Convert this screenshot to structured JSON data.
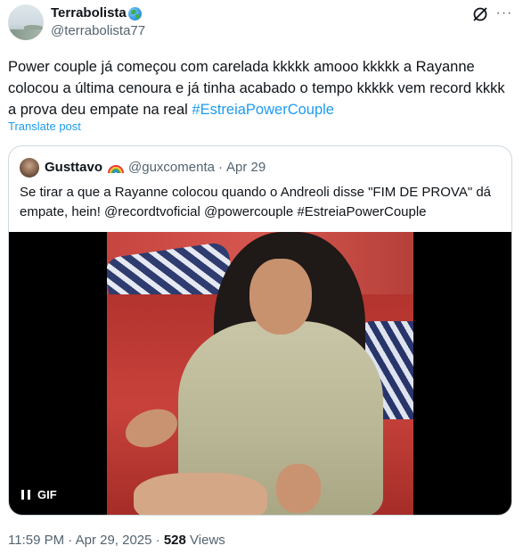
{
  "post": {
    "author_name": "Terrabolista",
    "author_emoji_icon": "globe-icon",
    "author_handle": "@terrabolista77",
    "text": "Power couple já começou com carelada kkkkk amooo kkkkk a Rayanne colocou a última cenoura e já tinha acabado o tempo kkkkk vem record kkkk a prova deu empate na real ",
    "hashtag": "#EstreiaPowerCouple",
    "translate_label": "Translate post",
    "timestamp": "11:59 PM · Apr 29, 2025",
    "views_count": "528",
    "views_label": "Views"
  },
  "quote": {
    "author_name": "Gusttavo",
    "author_emoji_icon": "rainbow-icon",
    "author_handle": "@guxcomenta",
    "separator": "·",
    "date": "Apr 29",
    "text": "Se tirar a que a Rayanne colocou quando o Andreoli disse \"FIM DE PROVA\" dá empate, hein! @recordtvoficial @powercouple #EstreiaPowerCouple",
    "media_badge": "GIF"
  },
  "icons": {
    "top_right_1": "grok-icon",
    "top_right_2": "more-icon"
  },
  "colors": {
    "link": "#1d9bf0",
    "secondary_text": "#536471",
    "primary_text": "#0f1419",
    "border": "#cfd9de"
  }
}
